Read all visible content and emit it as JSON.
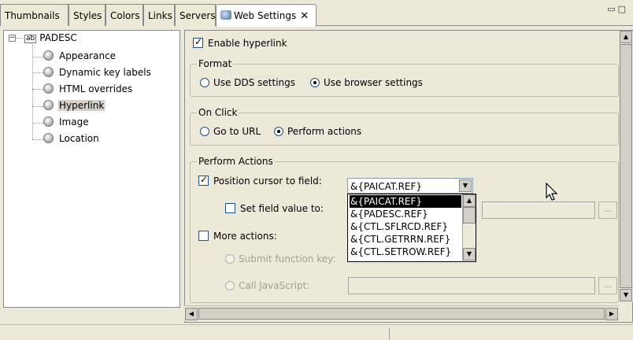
{
  "tabs": [
    {
      "label": "Thumbnails"
    },
    {
      "label": "Styles"
    },
    {
      "label": "Colors"
    },
    {
      "label": "Links"
    },
    {
      "label": "Servers"
    },
    {
      "label": "Web Settings",
      "active": true,
      "close": "✕"
    }
  ],
  "window_controls": {
    "minimize": "▭",
    "maximize": "□"
  },
  "tree": {
    "root": {
      "label": "PADESC",
      "badge": "ab",
      "expander": "−"
    },
    "items": [
      {
        "label": "Appearance",
        "icon": "circle-icon"
      },
      {
        "label": "Dynamic key labels",
        "icon": "circle-icon"
      },
      {
        "label": "HTML overrides",
        "icon": "circle-icon"
      },
      {
        "label": "Hyperlink",
        "icon": "check-circle-icon",
        "selected": true
      },
      {
        "label": "Image",
        "icon": "circle-icon"
      },
      {
        "label": "Location",
        "icon": "circle-icon"
      }
    ]
  },
  "settings": {
    "enable_hyperlink": {
      "label": "Enable hyperlink",
      "checked": true
    },
    "format": {
      "legend": "Format",
      "options": [
        {
          "label": "Use DDS settings",
          "selected": false
        },
        {
          "label": "Use browser settings",
          "selected": true
        }
      ]
    },
    "on_click": {
      "legend": "On Click",
      "options": [
        {
          "label": "Go to URL",
          "selected": false
        },
        {
          "label": "Perform actions",
          "selected": true
        }
      ]
    },
    "perform_actions": {
      "legend": "Perform Actions",
      "position_cursor": {
        "label": "Position cursor to field:",
        "checked": true,
        "value": "&{PAICAT.REF}"
      },
      "set_field_value": {
        "label": "Set field value to:",
        "checked": false,
        "browse": "..."
      },
      "more_actions": {
        "label": "More actions:",
        "checked": false
      },
      "submit_function_key": {
        "label": "Submit function key:",
        "selected": false
      },
      "call_javascript": {
        "label": "Call JavaScript:",
        "selected": false,
        "browse": "..."
      }
    },
    "dropdown_options": [
      {
        "label": "&{PAICAT.REF}",
        "selected": true
      },
      {
        "label": "&{PADESC.REF}"
      },
      {
        "label": "&{CTL.SFLRCD.REF}"
      },
      {
        "label": "&{CTL.GETRRN.REF}"
      },
      {
        "label": "&{CTL.SETROW.REF}"
      }
    ]
  },
  "colors": {
    "selection": "#000000",
    "accent": "#1c5180"
  }
}
